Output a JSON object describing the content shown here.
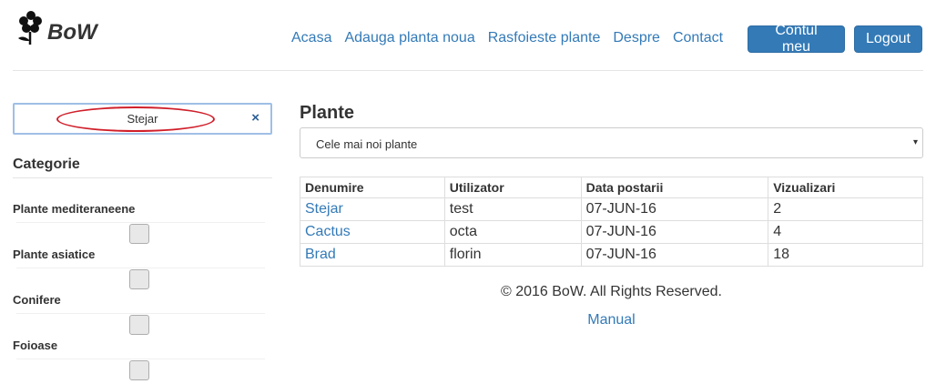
{
  "header": {
    "logo_text": "BoW",
    "nav": [
      "Acasa",
      "Adauga planta noua",
      "Rasfoieste plante",
      "Despre",
      "Contact"
    ],
    "account_button": "Contul meu",
    "logout_button": "Logout"
  },
  "sidebar": {
    "search_value": "Stejar",
    "clear_symbol": "×",
    "category_title": "Categorie",
    "categories": [
      "Plante mediteraneene",
      "Plante asiatice",
      "Conifere",
      "Foioase"
    ]
  },
  "main": {
    "title": "Plante",
    "sort_selected": "Cele mai noi plante",
    "sort_caret": "▾",
    "table": {
      "headers": [
        "Denumire",
        "Utilizator",
        "Data postarii",
        "Vizualizari"
      ],
      "rows": [
        [
          "Stejar",
          "test",
          "07-JUN-16",
          "2"
        ],
        [
          "Cactus",
          "octa",
          "07-JUN-16",
          "4"
        ],
        [
          "Brad",
          "florin",
          "07-JUN-16",
          "18"
        ]
      ]
    }
  },
  "footer": {
    "copyright": "© 2016 BoW. All Rights Reserved.",
    "manual_link": "Manual"
  },
  "colors": {
    "link": "#337ab7",
    "primary_button": "#337ab7",
    "highlight_ellipse": "#d01f2a"
  },
  "icons": {
    "logo": "flower-icon",
    "clear": "close-icon",
    "caret": "caret-down-icon"
  }
}
